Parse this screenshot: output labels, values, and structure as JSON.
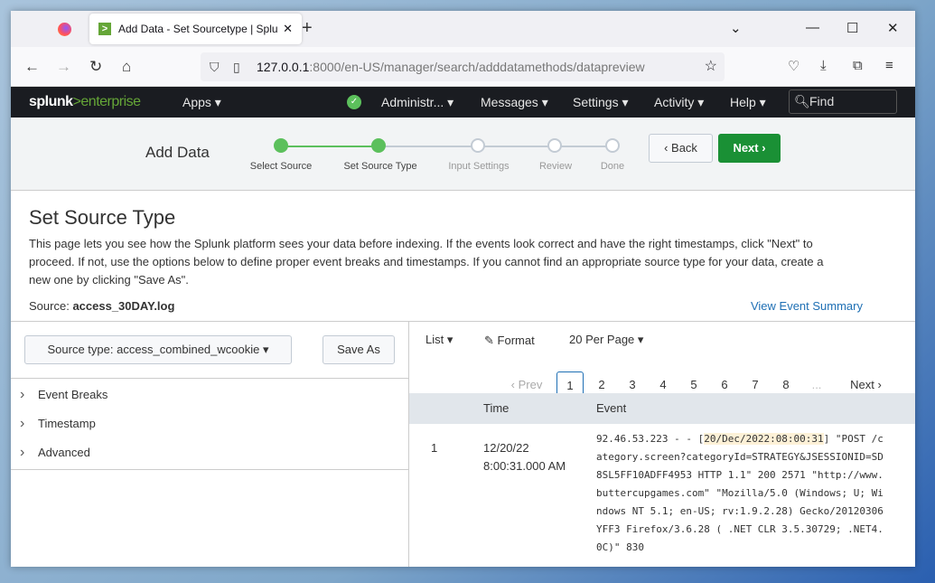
{
  "browser": {
    "tab_title": "Add Data - Set Sourcetype | Splu",
    "url_host": "127.0.0.1",
    "url_rest": ":8000/en-US/manager/search/adddatamethods/datapreview"
  },
  "splunk_bar": {
    "logo_main": "splunk",
    "logo_accent": ">enterprise",
    "apps": "Apps ▾",
    "admin": "Administr... ▾",
    "messages": "Messages ▾",
    "settings": "Settings ▾",
    "activity": "Activity ▾",
    "help": "Help ▾",
    "find_placeholder": "Find"
  },
  "wizard": {
    "title": "Add Data",
    "steps": [
      {
        "label": "Select Source",
        "done": true
      },
      {
        "label": "Set Source Type",
        "done": true
      },
      {
        "label": "Input Settings",
        "done": false
      },
      {
        "label": "Review",
        "done": false
      },
      {
        "label": "Done",
        "done": false
      }
    ],
    "back": "‹ Back",
    "next": "Next ›"
  },
  "page": {
    "title": "Set Source Type",
    "description": "This page lets you see how the Splunk platform sees your data before indexing. If the events look correct and have the right timestamps, click \"Next\" to proceed. If not, use the options below to define proper event breaks and timestamps. If you cannot find an appropriate source type for your data, create a new one by clicking \"Save As\".",
    "source_label": "Source:",
    "source_value": "access_30DAY.log",
    "view_summary": "View Event Summary"
  },
  "left": {
    "sourcetype": "Source type: access_combined_wcookie ▾",
    "save_as": "Save As",
    "sections": [
      "Event Breaks",
      "Timestamp",
      "Advanced"
    ]
  },
  "right": {
    "list": "List ▾",
    "format": "Format",
    "per_page": "20 Per Page ▾",
    "prev": "‹ Prev",
    "pages": [
      "1",
      "2",
      "3",
      "4",
      "5",
      "6",
      "7",
      "8"
    ],
    "ellipsis": "...",
    "next": "Next ›",
    "col_time": "Time",
    "col_event": "Event",
    "events": [
      {
        "num": "1",
        "date": "12/20/22",
        "time": "8:00:31.000 AM",
        "pre": "92.46.53.223 - - [",
        "ts": "20/Dec/2022:08:00:31",
        "post": "] \"POST /c",
        "rest": "ategory.screen?categoryId=STRATEGY&JSESSIONID=SD\n8SL5FF10ADFF4953 HTTP 1.1\" 200 2571 \"http://www.\nbuttercupgames.com\" \"Mozilla/5.0 (Windows; U; Wi\nndows NT 5.1; en-US; rv:1.9.2.28) Gecko/20120306\nYFF3 Firefox/3.6.28 ( .NET CLR 3.5.30729; .NET4.\n0C)\" 830"
      }
    ]
  }
}
